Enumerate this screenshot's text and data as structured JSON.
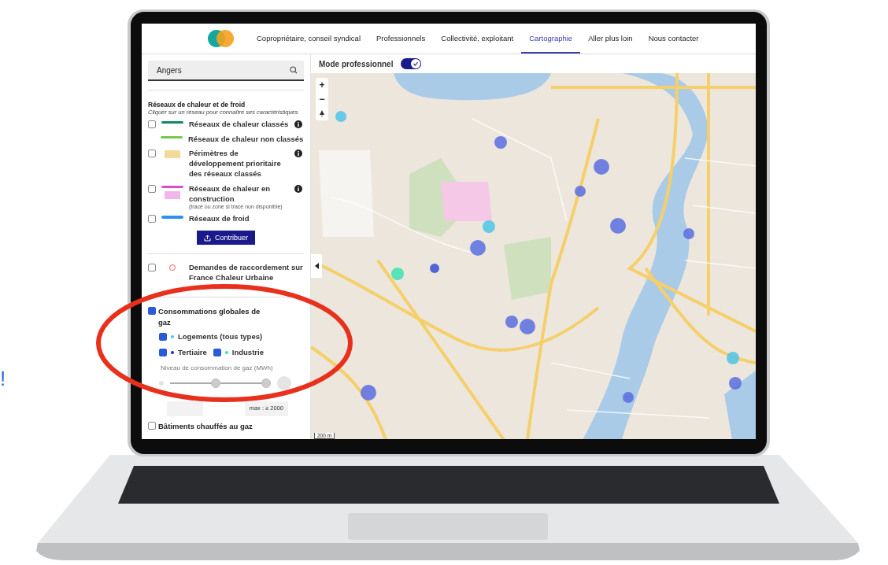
{
  "nav": {
    "items": [
      {
        "label": "Copropriétaire, conseil syndical",
        "selected": false
      },
      {
        "label": "Professionnels",
        "selected": false
      },
      {
        "label": "Collectivité, exploitant",
        "selected": false
      },
      {
        "label": "Cartographie",
        "selected": true
      },
      {
        "label": "Aller plus loin",
        "selected": false
      },
      {
        "label": "Nous contacter",
        "selected": false
      }
    ]
  },
  "search": {
    "value": "Angers"
  },
  "networks": {
    "title": "Réseaux de chaleur et de froid",
    "subtitle": "Cliquer sur un réseau pour connaître ses caractéristiques",
    "layers": [
      {
        "label": "Réseaux de chaleur classés",
        "checkbox": true,
        "checked": false,
        "info": true,
        "swatches": [
          {
            "kind": "line",
            "color": "#0f8a5f"
          }
        ]
      },
      {
        "label": "Réseaux de chaleur non classés",
        "checkbox": false,
        "info": false,
        "swatches": [
          {
            "kind": "line",
            "color": "#78c850"
          }
        ]
      },
      {
        "label": "Périmètres de développement prioritaire des réseaux classés",
        "checkbox": true,
        "checked": false,
        "info": true,
        "swatches": [
          {
            "kind": "area",
            "color": "#f5d99a"
          }
        ]
      },
      {
        "label": "Réseaux de chaleur en construction",
        "note": "(tracé ou zone si tracé non disponible)",
        "checkbox": true,
        "checked": false,
        "info": true,
        "swatches": [
          {
            "kind": "line",
            "color": "#d94fc8"
          },
          {
            "kind": "area",
            "color": "#f0b8ea"
          }
        ]
      },
      {
        "label": "Réseaux de froid",
        "checkbox": true,
        "checked": false,
        "info": false,
        "swatches": [
          {
            "kind": "line",
            "color": "#2f8ef0"
          }
        ]
      }
    ],
    "button": "Contribuer"
  },
  "requests": {
    "label": "Demandes de raccordement sur France Chaleur Urbaine",
    "checked": false
  },
  "gas": {
    "label": "Consommations globales de gaz",
    "checked": true,
    "types": [
      {
        "label": "Logements (tous types)",
        "checked": true,
        "color": "#4fc3e8"
      },
      {
        "label": "Tertiaire",
        "checked": true,
        "color": "#2a2ab8"
      },
      {
        "label": "Industrie",
        "checked": true,
        "color": "#3de0b0"
      }
    ],
    "slider_label": "Niveau de consommation de gaz (MWh)",
    "min_thumb": {
      "level": 0.45
    },
    "max_thumb": {
      "level": 0.95
    },
    "max_text": "max : ≥ 2000"
  },
  "buildings": {
    "label": "Bâtiments chauffés au gaz",
    "checked": false
  },
  "mode": {
    "label": "Mode professionnel",
    "on": true
  },
  "map": {
    "zoom_in": "+",
    "zoom_out": "−",
    "scale": "200 m"
  },
  "side_mark": "!"
}
